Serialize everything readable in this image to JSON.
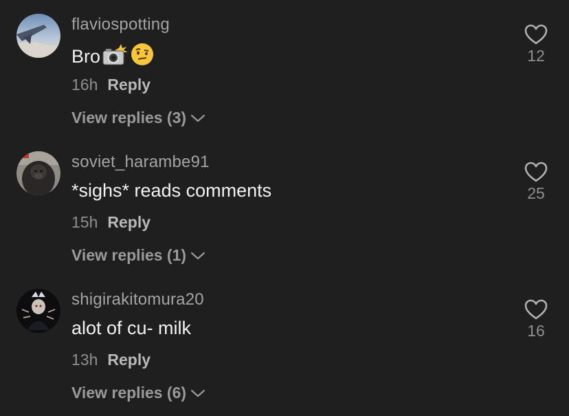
{
  "comments": [
    {
      "username": "flaviospotting",
      "text": "Bro",
      "emojis": [
        "camera-flash-emoji",
        "raised-eyebrow-emoji"
      ],
      "time": "16h",
      "reply_label": "Reply",
      "view_replies": "View replies (3)",
      "likes": "12"
    },
    {
      "username": "soviet_harambe91",
      "text": "*sighs* reads comments",
      "time": "15h",
      "reply_label": "Reply",
      "view_replies": "View replies (1)",
      "likes": "25"
    },
    {
      "username": "shigirakitomura20",
      "text": "alot of cu- milk",
      "time": "13h",
      "reply_label": "Reply",
      "view_replies": "View replies (6)",
      "likes": "16"
    }
  ],
  "icons": {
    "like": "heart-outline-icon",
    "expand": "chevron-down-icon"
  },
  "colors": {
    "background": "#1f1f1f",
    "username": "#a4a4a4",
    "text": "#f2f2f2",
    "muted": "#8f8f8f"
  }
}
